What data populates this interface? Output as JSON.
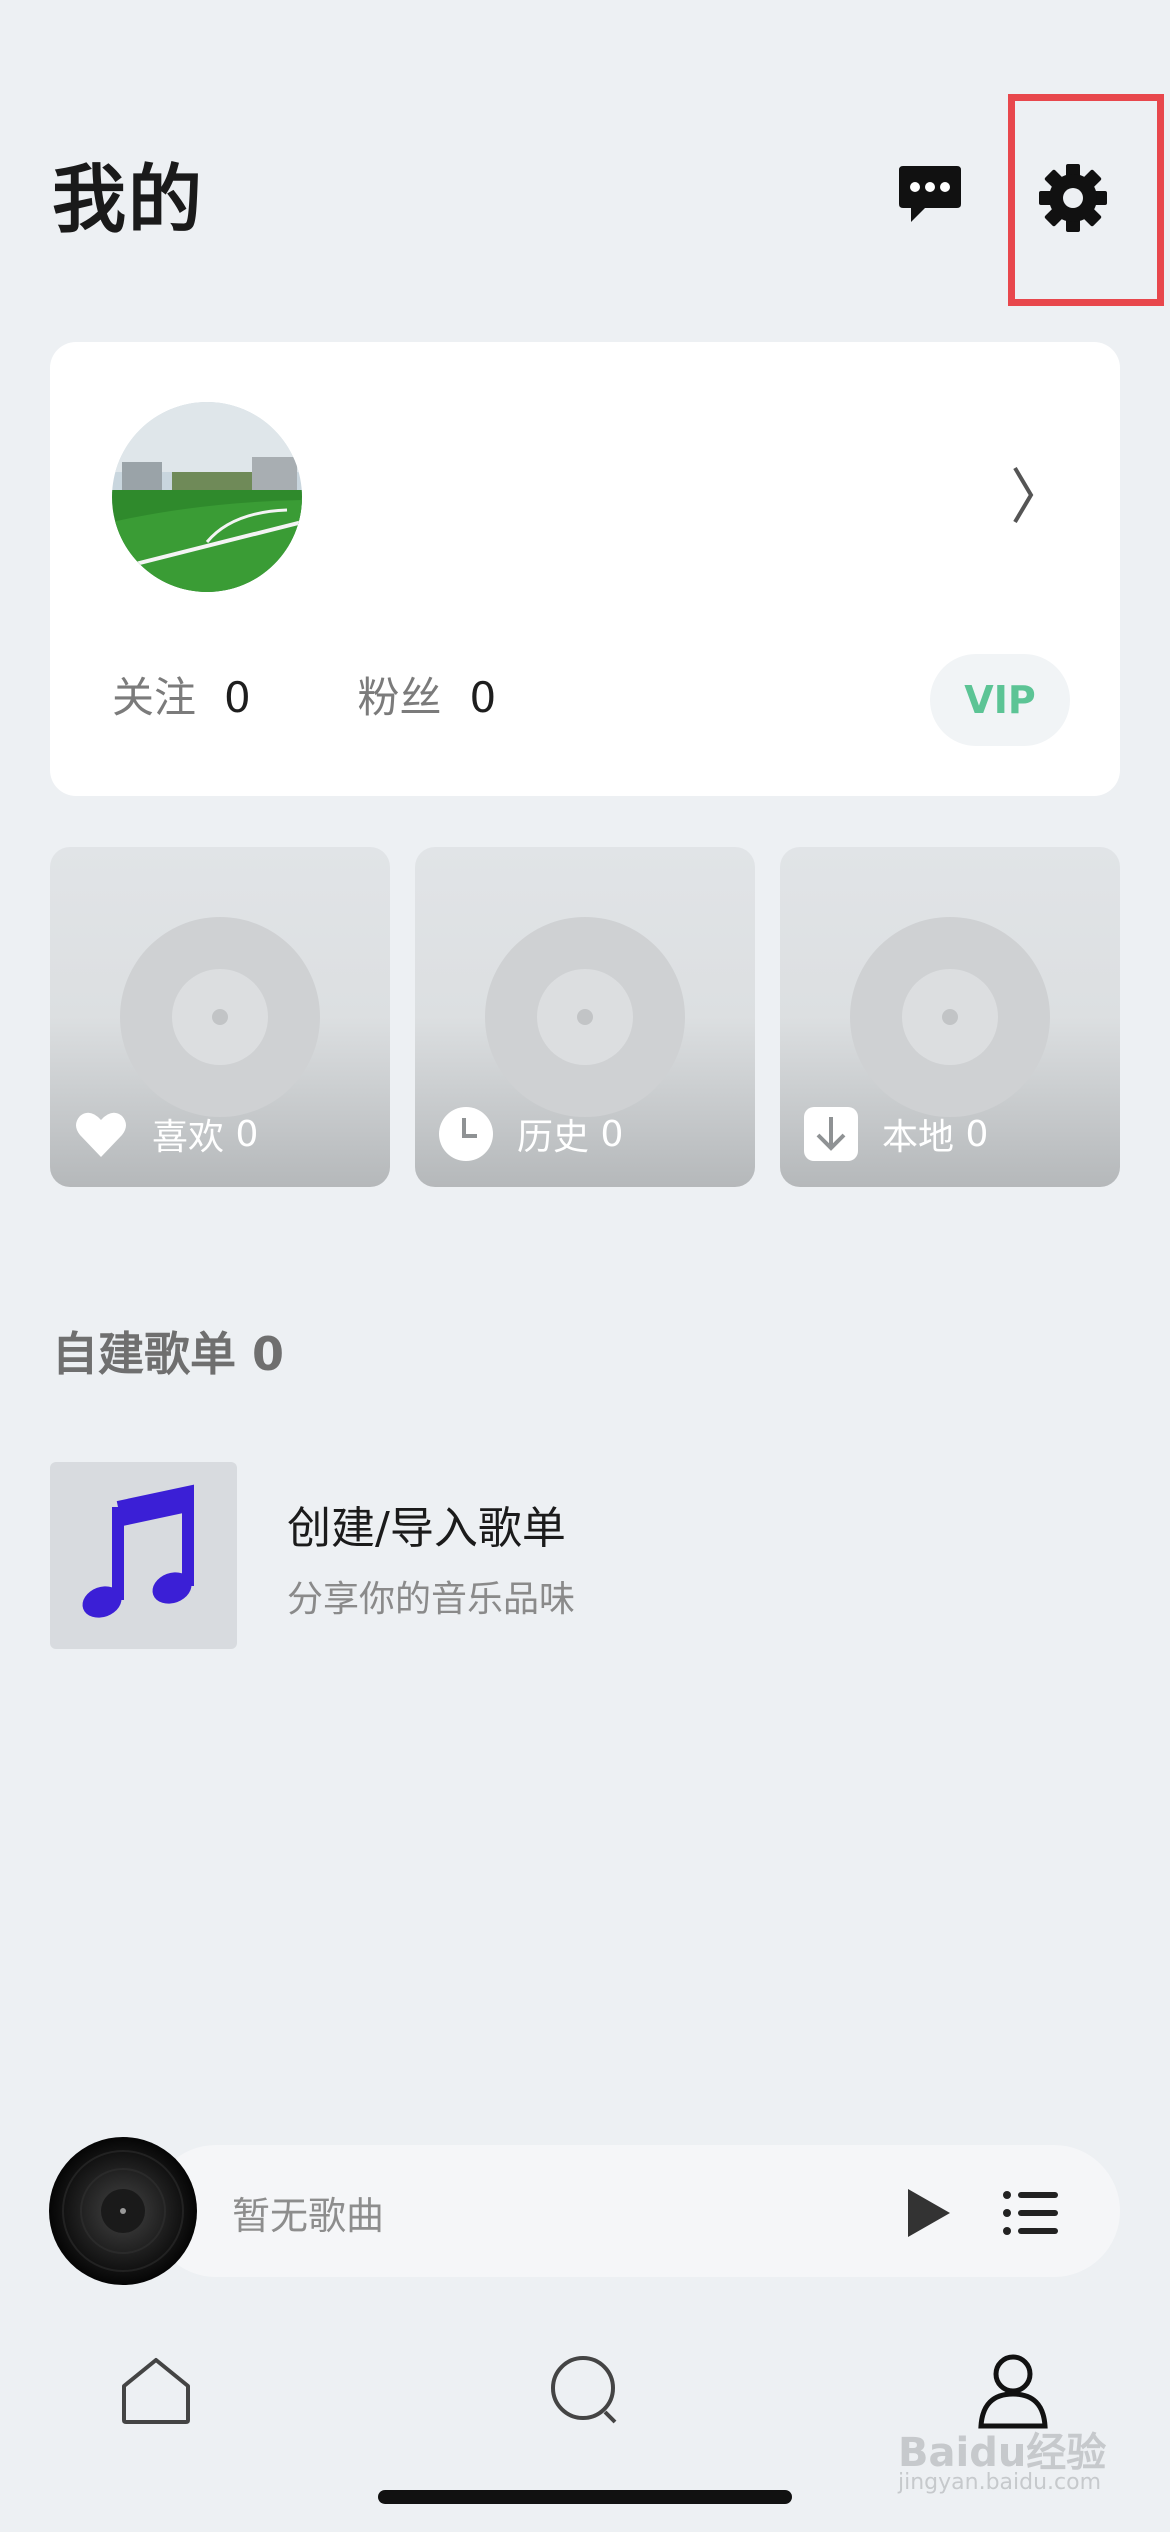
{
  "header": {
    "title": "我的"
  },
  "profile": {
    "stats": [
      {
        "label": "关注",
        "value": "0"
      },
      {
        "label": "粉丝",
        "value": "0"
      }
    ],
    "vip_label": "VIP"
  },
  "tiles": [
    {
      "label": "喜欢",
      "count": "0",
      "icon": "heart-icon"
    },
    {
      "label": "历史",
      "count": "0",
      "icon": "clock-icon"
    },
    {
      "label": "本地",
      "count": "0",
      "icon": "download-icon"
    }
  ],
  "playlists": {
    "section_title": "自建歌单",
    "count": "0",
    "create": {
      "title": "创建/导入歌单",
      "subtitle": "分享你的音乐品味"
    }
  },
  "player": {
    "text": "暂无歌曲"
  },
  "tabbar": {
    "items": [
      "home-icon",
      "search-icon",
      "profile-icon"
    ]
  },
  "watermark": {
    "text": "Baidu经验",
    "sub": "jingyan.baidu.com"
  },
  "colors": {
    "accent_vip": "#5cc495",
    "highlight": "#e8474c",
    "note_icon": "#3b1fd6"
  }
}
